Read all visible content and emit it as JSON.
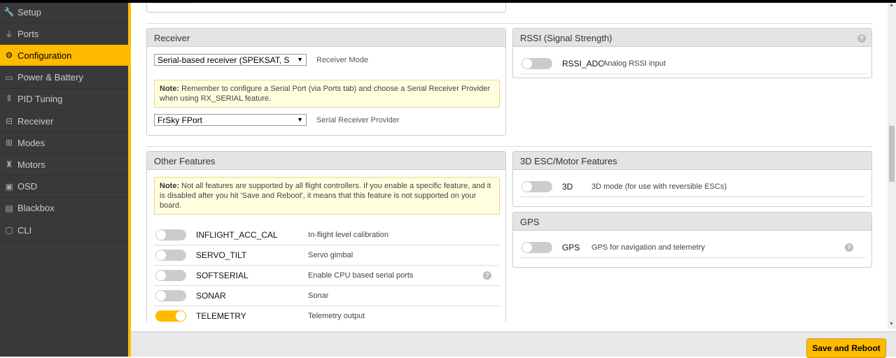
{
  "sidebar": {
    "items": [
      {
        "label": "Setup",
        "icon": "wrench-icon",
        "active": false
      },
      {
        "label": "Ports",
        "icon": "plug-icon",
        "active": false
      },
      {
        "label": "Configuration",
        "icon": "gear-icon",
        "active": true
      },
      {
        "label": "Power & Battery",
        "icon": "battery-icon",
        "active": false
      },
      {
        "label": "PID Tuning",
        "icon": "pid-icon",
        "active": false
      },
      {
        "label": "Receiver",
        "icon": "receiver-icon",
        "active": false
      },
      {
        "label": "Modes",
        "icon": "modes-icon",
        "active": false
      },
      {
        "label": "Motors",
        "icon": "motor-icon",
        "active": false
      },
      {
        "label": "OSD",
        "icon": "osd-icon",
        "active": false
      },
      {
        "label": "Blackbox",
        "icon": "blackbox-icon",
        "active": false
      },
      {
        "label": "CLI",
        "icon": "cli-icon",
        "active": false
      }
    ]
  },
  "receiver": {
    "title": "Receiver",
    "mode_value": "Serial-based receiver (SPEKSAT, S",
    "mode_label": "Receiver Mode",
    "note_bold": "Note:",
    "note_text": " Remember to configure a Serial Port (via Ports tab) and choose a Serial Receiver Provider when using RX_SERIAL feature.",
    "provider_value": "FrSky FPort",
    "provider_label": "Serial Receiver Provider"
  },
  "rssi": {
    "title": "RSSI (Signal Strength)",
    "feature_name": "RSSI_ADC",
    "feature_desc": "Analog RSSI input"
  },
  "other_features": {
    "title": "Other Features",
    "note_bold": "Note:",
    "note_text": " Not all features are supported by all flight controllers. If you enable a specific feature, and it is disabled after you hit 'Save and Reboot', it means that this feature is not supported on your board.",
    "features": [
      {
        "name": "INFLIGHT_ACC_CAL",
        "desc": "In-flight level calibration",
        "on": false,
        "help": false
      },
      {
        "name": "SERVO_TILT",
        "desc": "Servo gimbal",
        "on": false,
        "help": false
      },
      {
        "name": "SOFTSERIAL",
        "desc": "Enable CPU based serial ports",
        "on": false,
        "help": true
      },
      {
        "name": "SONAR",
        "desc": "Sonar",
        "on": false,
        "help": false
      },
      {
        "name": "TELEMETRY",
        "desc": "Telemetry output",
        "on": true,
        "help": false
      }
    ]
  },
  "esc3d": {
    "title": "3D ESC/Motor Features",
    "feature_name": "3D",
    "feature_desc": "3D mode (for use with reversible ESCs)"
  },
  "gps": {
    "title": "GPS",
    "feature_name": "GPS",
    "feature_desc": "GPS for navigation and telemetry"
  },
  "footer": {
    "save_label": "Save and Reboot"
  },
  "colors": {
    "accent": "#ffbb00",
    "sidebar_bg": "#393939"
  }
}
